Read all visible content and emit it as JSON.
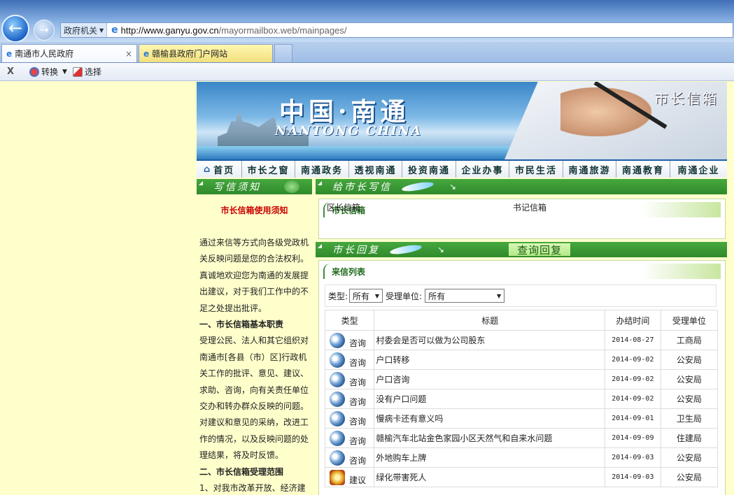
{
  "browser": {
    "zone_label": "政府机关",
    "url_host": "http://www.ganyu.gov.cn",
    "url_path": "/mayormailbox.web/mainpages/",
    "tabs": [
      {
        "title": "南通市人民政府",
        "close": "×"
      },
      {
        "title": "赣榆县政府门户网站"
      }
    ],
    "toolbar": {
      "close": "X",
      "convert": "转换",
      "select": "选择"
    }
  },
  "banner": {
    "title_cn": "中国·南通",
    "title_en": "NANTONG CHINA",
    "mailbox_label": "市长信箱"
  },
  "nav": {
    "items": [
      "首页",
      "市长之窗",
      "南通政务",
      "透视南通",
      "投资南通",
      "企业办事",
      "市民生活",
      "南通旅游",
      "南通教育",
      "南通企业"
    ]
  },
  "left": {
    "header": "写信须知",
    "notice_title": "市长信箱使用须知",
    "paragraphs": [
      {
        "text": "通过来信等方式向各级党政机关反映问题是您的合法权利。真诚地欢迎您为南通的发展提出建议，对于我们工作中的不足之处提出批评。",
        "heading": false
      },
      {
        "text": "一、市长信箱基本职责",
        "heading": true
      },
      {
        "text": "受理公民、法人和其它组织对南通市[各县（市）区]行政机关工作的批评、意见、建议、求助、咨询，向有关责任单位交办和转办群众反映的问题。对建议和意见的采纳，改进工作的情况，以及反映问题的处理结果，将及时反馈。",
        "heading": false
      },
      {
        "text": "二、市长信箱受理范围",
        "heading": true
      },
      {
        "text": "1、对我市改革开放、经济建",
        "heading": false
      }
    ]
  },
  "right": {
    "write_header": "给市长写信",
    "mailbox_box_title": "市长信箱",
    "mailbox_links": [
      "区长信箱",
      "书记信箱"
    ],
    "reply_header": "市长回复",
    "query_button": "查询回复",
    "list_title": "来信列表",
    "filter": {
      "type_label": "类型:",
      "type_value": "所有",
      "dept_label": "受理单位:",
      "dept_value": "所有"
    },
    "columns": [
      "类型",
      "标题",
      "办结时间",
      "受理单位"
    ],
    "rows": [
      {
        "type": "咨询",
        "icon": "consult-icon",
        "title": "村委会是否可以做为公司股东",
        "date": "2014-08-27",
        "dept": "工商局"
      },
      {
        "type": "咨询",
        "icon": "consult-icon",
        "title": "户口转移",
        "date": "2014-09-02",
        "dept": "公安局"
      },
      {
        "type": "咨询",
        "icon": "consult-icon",
        "title": "户口咨询",
        "date": "2014-09-02",
        "dept": "公安局"
      },
      {
        "type": "咨询",
        "icon": "consult-icon",
        "title": "没有户口问题",
        "date": "2014-09-02",
        "dept": "公安局"
      },
      {
        "type": "咨询",
        "icon": "consult-icon",
        "title": "慢病卡还有意义吗",
        "date": "2014-09-01",
        "dept": "卫生局"
      },
      {
        "type": "咨询",
        "icon": "consult-icon",
        "title": "赣榆汽车北站金色家园小区天然气和自来水问题",
        "date": "2014-09-09",
        "dept": "住建局"
      },
      {
        "type": "咨询",
        "icon": "consult-icon",
        "title": "外地购车上牌",
        "date": "2014-09-03",
        "dept": "公安局"
      },
      {
        "type": "建议",
        "icon": "advice-icon",
        "title": "绿化带害死人",
        "date": "2014-09-03",
        "dept": "公安局"
      }
    ]
  }
}
